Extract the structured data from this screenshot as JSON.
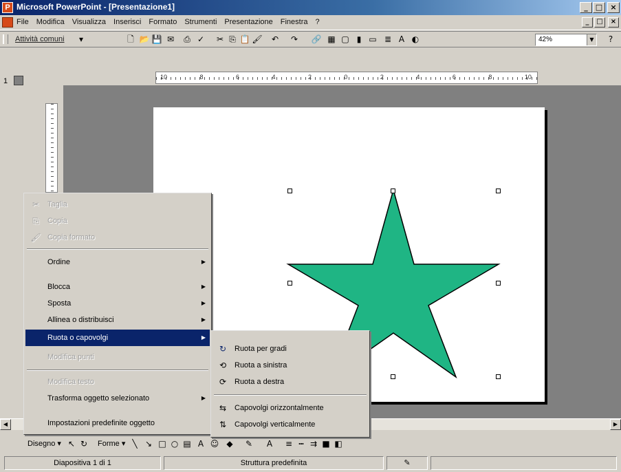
{
  "window": {
    "title": "Microsoft PowerPoint - [Presentazione1]",
    "caption_buttons": [
      "_",
      "□",
      "×"
    ]
  },
  "menubar": {
    "items": [
      "File",
      "Modifica",
      "Visualizza",
      "Inserisci",
      "Formato",
      "Strumenti",
      "Presentazione",
      "Finestra",
      "?"
    ]
  },
  "toolbar": {
    "tasks_label": "Attività comuni",
    "zoom": "42%"
  },
  "slide_panel": {
    "slide_number": "1"
  },
  "ruler": {
    "h_labels": [
      "10",
      "8",
      "6",
      "4",
      "2",
      "0",
      "2",
      "4",
      "6",
      "8",
      "10"
    ]
  },
  "shape": {
    "type": "star-5-point",
    "fill": "#1fb584",
    "stroke": "#000000"
  },
  "context_menu": {
    "items": [
      {
        "label": "Taglia",
        "disabled": true,
        "icon": "scissors-icon"
      },
      {
        "label": "Copia",
        "disabled": true,
        "icon": "copy-icon"
      },
      {
        "label": "Copia formato",
        "disabled": true,
        "icon": "format-painter-icon"
      },
      {
        "label": "Ordine",
        "submenu": true
      },
      {
        "label": "Blocca",
        "submenu": true
      },
      {
        "label": "Sposta",
        "submenu": true
      },
      {
        "label": "Allinea o distribuisci",
        "submenu": true
      },
      {
        "label": "Ruota o capovolgi",
        "submenu": true,
        "highlighted": true
      },
      {
        "label": "Modifica punti",
        "disabled": true
      },
      {
        "label": "Modifica testo",
        "disabled": true
      },
      {
        "label": "Trasforma oggetto selezionato",
        "submenu": true
      },
      {
        "label": "Impostazioni predefinite oggetto"
      }
    ]
  },
  "submenu": {
    "items": [
      {
        "label": "Ruota per gradi",
        "icon": "free-rotate-icon"
      },
      {
        "label": "Ruota a sinistra",
        "icon": "rotate-left-icon"
      },
      {
        "label": "Ruota a destra",
        "icon": "rotate-right-icon"
      },
      {
        "label": "Capovolgi orizzontalmente",
        "icon": "flip-horizontal-icon"
      },
      {
        "label": "Capovolgi verticalmente",
        "icon": "flip-vertical-icon"
      }
    ]
  },
  "drawing_toolbar": {
    "draw_label": "Disegno",
    "shapes_label": "Forme"
  },
  "statusbar": {
    "slide": "Diapositiva 1 di 1",
    "design": "Struttura predefinita"
  }
}
